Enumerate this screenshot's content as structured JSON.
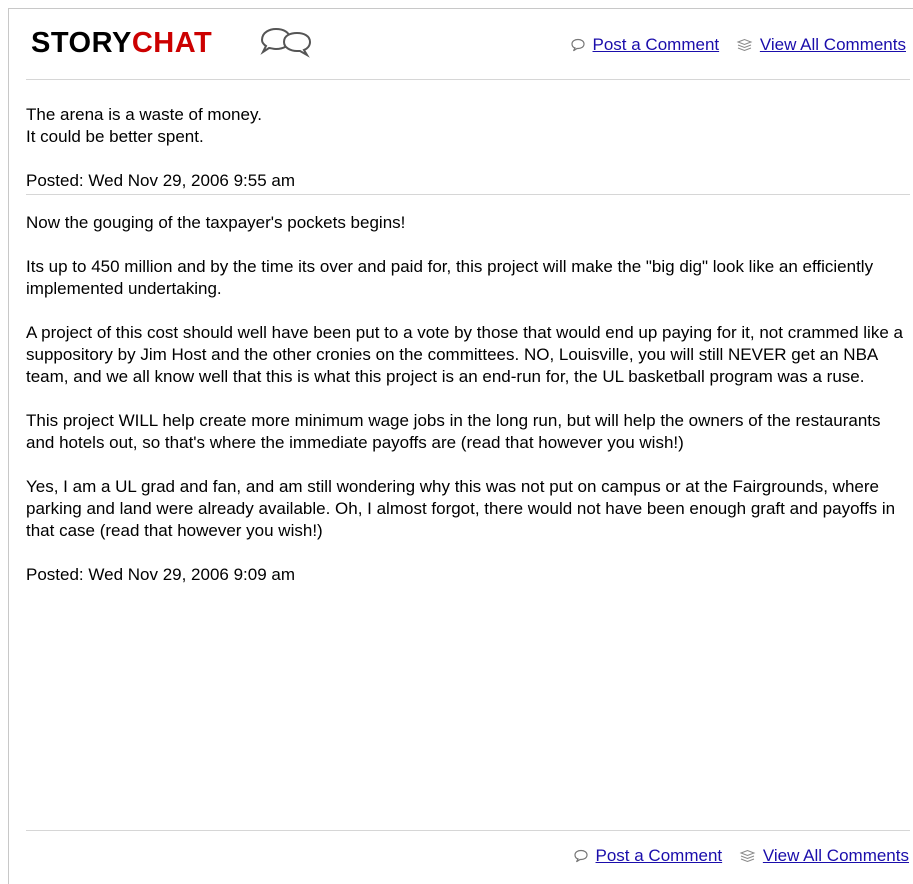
{
  "header": {
    "logo_story": "STORY",
    "logo_chat": "CHAT",
    "logo_icon": "speech-bubbles-icon",
    "post_comment": "Post a Comment",
    "view_all": "View All Comments"
  },
  "posts": [
    {
      "paragraphs": [
        "The arena is a waste of money.\nIt could be better spent."
      ],
      "posted": "Posted: Wed Nov 29, 2006 9:55 am"
    },
    {
      "paragraphs": [
        "Now the gouging of the taxpayer's pockets begins!",
        "Its up to 450 million and by the time its over and paid for, this project will make the \"big dig\" look like an efficiently implemented undertaking.",
        "A project of this cost should well have been put to a vote by those that would end up paying for it, not crammed like a suppository by Jim Host and the other cronies on the committees. NO, Louisville, you will still NEVER get an NBA team, and we all know well that this is what this project is an end-run for, the UL basketball program was a ruse.",
        "This project WILL help create more minimum wage jobs in the long run, but will help the owners of the restaurants and hotels out, so that's where the immediate payoffs are (read that however you wish!)",
        "Yes, I am a UL grad and fan, and am still wondering why this was not put on campus or at the Fairgrounds, where parking and land were already available. Oh, I almost forgot, there would not have been enough graft and payoffs in that case (read that however you wish!)"
      ],
      "posted": "Posted: Wed Nov 29, 2006 9:09 am"
    }
  ],
  "footer": {
    "post_comment": "Post a Comment",
    "view_all": "View All Comments"
  },
  "icons": {
    "comment": "comment-bubble-icon",
    "view_all": "stacked-comments-icon"
  }
}
